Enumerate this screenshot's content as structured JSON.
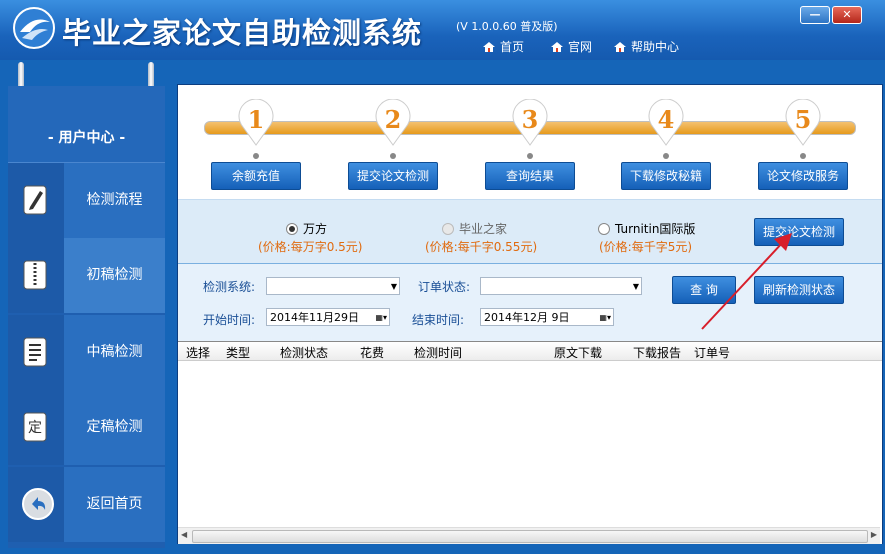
{
  "app": {
    "title": "毕业之家论文自助检测系统",
    "version": "(V 1.0.0.60 普及版)",
    "nav": [
      "首页",
      "官网",
      "帮助中心"
    ],
    "window_buttons": {
      "minimize": "—",
      "close": "✕"
    }
  },
  "sidebar": {
    "title": "- 用户中心 -",
    "items": [
      {
        "label": "检测流程",
        "icon": "pencil-doc-icon"
      },
      {
        "label": "初稿检测",
        "icon": "zipper-doc-icon"
      },
      {
        "label": "中稿检测",
        "icon": "text-doc-icon"
      },
      {
        "label": "定稿检测",
        "icon": "final-doc-icon"
      },
      {
        "label": "返回首页",
        "icon": "back-arrow-icon"
      }
    ]
  },
  "steps": {
    "numbers": [
      "1",
      "2",
      "3",
      "4",
      "5"
    ],
    "buttons": [
      "余额充值",
      "提交论文检测",
      "查询结果",
      "下载修改秘籍",
      "论文修改服务"
    ]
  },
  "options": {
    "systems": [
      {
        "name": "万方",
        "price": "(价格:每万字0.5元)",
        "selected": true,
        "enabled": true
      },
      {
        "name": "毕业之家",
        "price": "(价格:每千字0.55元)",
        "selected": false,
        "enabled": false
      },
      {
        "name": "Turnitin国际版",
        "price": "(价格:每千字5元)",
        "selected": false,
        "enabled": true
      }
    ],
    "submit_button": "提交论文检测"
  },
  "filter": {
    "system_label": "检测系统:",
    "system_value": "",
    "order_status_label": "订单状态:",
    "order_status_value": "",
    "start_label": "开始时间:",
    "start_value": "2014年11月29日",
    "end_label": "结束时间:",
    "end_value": "2014年12月 9日",
    "query_button": "查 询",
    "refresh_button": "刷新检测状态"
  },
  "table": {
    "columns": [
      "选择",
      "类型",
      "检测状态",
      "花费",
      "检测时间",
      "原文下载",
      "下载报告",
      "订单号"
    ],
    "rows": []
  },
  "colors": {
    "accent": "#1565b8",
    "orange": "#e69a1c",
    "price": "#e06b10",
    "arrow": "#d81e2a"
  }
}
